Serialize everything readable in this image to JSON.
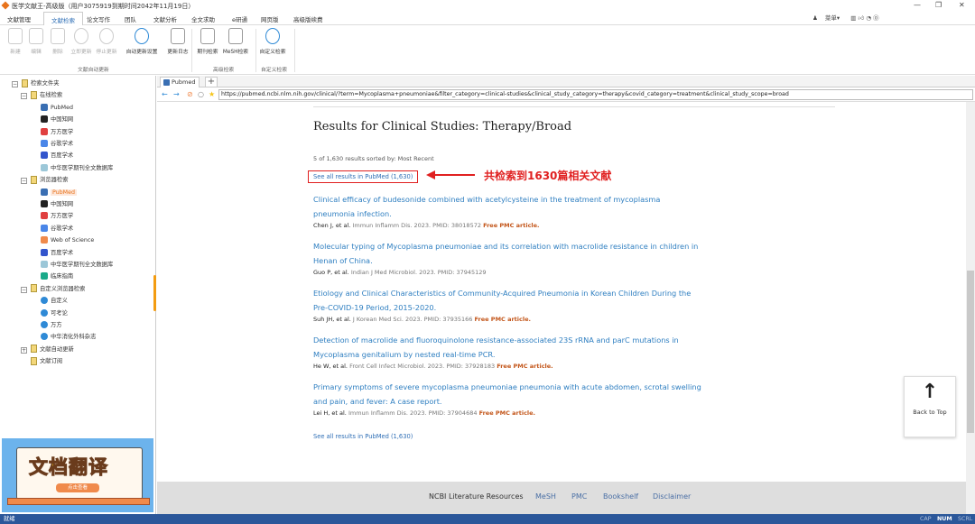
{
  "window": {
    "title": "医学文献王-高级版（用户3075919到期时间2042年11月19日）",
    "controls": [
      "—",
      "❐",
      "✕"
    ]
  },
  "menu_tabs": [
    "文献管理",
    "文献检索",
    "论文写作",
    "团队",
    "文献分析",
    "全文求助",
    "e研通",
    "网页版",
    "高级版续费"
  ],
  "active_tab": 1,
  "toolbar_right": {
    "menu_label": "菜单▾"
  },
  "ribbon": {
    "buttons": [
      {
        "label": "新建",
        "disabled": true
      },
      {
        "label": "编辑",
        "disabled": true
      },
      {
        "label": "删除",
        "disabled": true
      },
      {
        "label": "立即更新",
        "disabled": true
      },
      {
        "label": "停止更新",
        "disabled": true
      },
      {
        "label": "自动更新设置",
        "disabled": false
      },
      {
        "label": "更新日志",
        "disabled": false
      },
      {
        "label": "期刊检索",
        "disabled": false
      },
      {
        "label": "MeSH检索",
        "disabled": false
      },
      {
        "label": "自定义检索",
        "disabled": false
      }
    ],
    "groups": [
      "文献自动更新",
      "高级检索",
      "自定义检索"
    ]
  },
  "tree": {
    "root": "检索文件夹",
    "online": {
      "label": "在线检索",
      "items": [
        "PubMed",
        "中国知网",
        "万方医学",
        "谷歌学术",
        "百度学术",
        "中华医学期刊全文数据库"
      ]
    },
    "browser": {
      "label": "浏览器检索",
      "items": [
        "PubMed",
        "中国知网",
        "万方医学",
        "谷歌学术",
        "Web of Science",
        "百度学术",
        "中华医学期刊全文数据库",
        "临床指南"
      ],
      "selected": 0
    },
    "custom": {
      "label": "自定义浏览器检索",
      "items": [
        "自定义",
        "可考论",
        "万方",
        "中华消化外科杂志"
      ]
    },
    "auto_update": "文献自动更新",
    "subscribe": "文献订阅"
  },
  "banner": {
    "title": "文档翻译",
    "button": "点击查看"
  },
  "browser": {
    "tab_label": "Pubmed",
    "new_tab": "+",
    "url": "https://pubmed.ncbi.nlm.nih.gov/clinical/?term=Mycoplasma+pneumoniae&filter_category=clinical-studies&clinical_study_category=therapy&covid_category=treatment&clinical_study_scope=broad"
  },
  "page": {
    "heading": "Results for Clinical Studies: Therapy/Broad",
    "summary": "5 of 1,630 results sorted by: Most Recent",
    "see_all": "See all results in PubMed (1,630)",
    "annotation": "共检索到1630篇相关文献",
    "articles": [
      {
        "title": "Clinical efficacy of budesonide combined with acetylcysteine in the treatment of mycoplasma pneumonia infection.",
        "authors": "Chen J, et al.",
        "journal": "Immun Inflamm Dis. 2023. PMID: 38018572",
        "free": "Free PMC article."
      },
      {
        "title": "Molecular typing of Mycoplasma pneumoniae and its correlation with macrolide resistance in children in Henan of China.",
        "authors": "Guo P, et al.",
        "journal": "Indian J Med Microbiol. 2023. PMID: 37945129",
        "free": ""
      },
      {
        "title": "Etiology and Clinical Characteristics of Community-Acquired Pneumonia in Korean Children During the Pre-COVID-19 Period, 2015-2020.",
        "authors": "Suh JH, et al.",
        "journal": "J Korean Med Sci. 2023. PMID: 37935166",
        "free": "Free PMC article."
      },
      {
        "title": "Detection of macrolide and fluoroquinolone resistance-associated 23S rRNA and parC mutations in Mycoplasma genitalium by nested real-time PCR.",
        "authors": "He W, et al.",
        "journal": "Front Cell Infect Microbiol. 2023. PMID: 37928183",
        "free": "Free PMC article."
      },
      {
        "title": "Primary symptoms of severe mycoplasma pneumoniae pneumonia with acute abdomen, scrotal swelling and pain, and fever: A case report.",
        "authors": "Lei H, et al.",
        "journal": "Immun Inflamm Dis. 2023. PMID: 37904684",
        "free": "Free PMC article."
      }
    ],
    "back_to_top": "Back to Top",
    "footer_links": [
      "NCBI Literature Resources",
      "MeSH",
      "PMC",
      "Bookshelf",
      "Disclaimer"
    ]
  },
  "status": {
    "left": "就绪",
    "indicators": [
      "CAP",
      "NUM",
      "SCRL"
    ]
  },
  "colors": {
    "accent": "#2f6fb6",
    "status_bar": "#2b579a",
    "annotation": "#e02020",
    "free_pmc": "#c3561a"
  }
}
